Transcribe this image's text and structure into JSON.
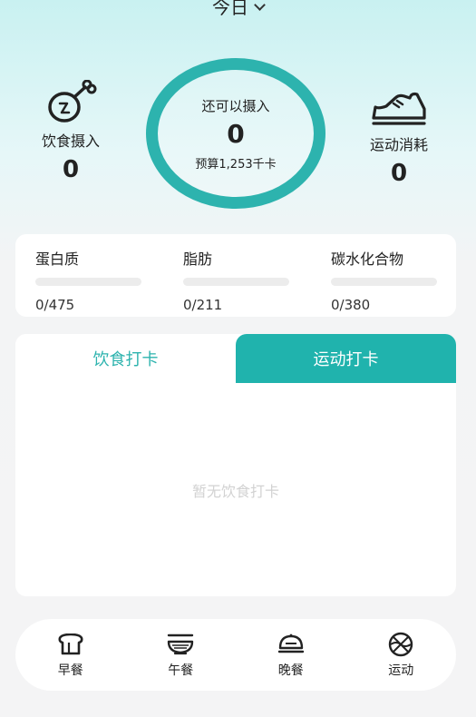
{
  "header": {
    "title": "今日"
  },
  "intake": {
    "label": "饮食摄入",
    "value": "0",
    "icon": "drumstick-icon"
  },
  "burned": {
    "label": "运动消耗",
    "value": "0",
    "icon": "sneaker-icon"
  },
  "remaining": {
    "label": "还可以摄入",
    "value": "0",
    "budget": "预算1,253千卡",
    "ring_color": "#2db3ae"
  },
  "macros": [
    {
      "name": "蛋白质",
      "value": "0/475"
    },
    {
      "name": "脂肪",
      "value": "0/211"
    },
    {
      "name": "碳水化合物",
      "value": "0/380"
    }
  ],
  "tabs": {
    "diet": "饮食打卡",
    "sport": "运动打卡",
    "active_color": "#20b3ad"
  },
  "empty_text": "暂无饮食打卡",
  "bottom_nav": [
    {
      "label": "早餐",
      "icon": "bread-icon"
    },
    {
      "label": "午餐",
      "icon": "noodle-bowl-icon"
    },
    {
      "label": "晚餐",
      "icon": "covered-dish-icon"
    },
    {
      "label": "运动",
      "icon": "basketball-icon"
    }
  ]
}
